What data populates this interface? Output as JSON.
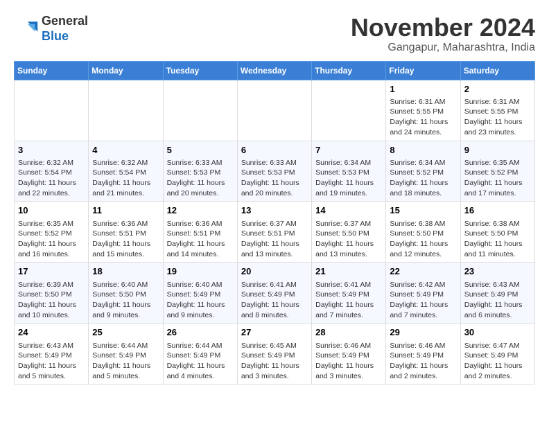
{
  "header": {
    "logo_general": "General",
    "logo_blue": "Blue",
    "month_title": "November 2024",
    "location": "Gangapur, Maharashtra, India"
  },
  "days_of_week": [
    "Sunday",
    "Monday",
    "Tuesday",
    "Wednesday",
    "Thursday",
    "Friday",
    "Saturday"
  ],
  "weeks": [
    [
      {
        "day": "",
        "info": ""
      },
      {
        "day": "",
        "info": ""
      },
      {
        "day": "",
        "info": ""
      },
      {
        "day": "",
        "info": ""
      },
      {
        "day": "",
        "info": ""
      },
      {
        "day": "1",
        "info": "Sunrise: 6:31 AM\nSunset: 5:55 PM\nDaylight: 11 hours and 24 minutes."
      },
      {
        "day": "2",
        "info": "Sunrise: 6:31 AM\nSunset: 5:55 PM\nDaylight: 11 hours and 23 minutes."
      }
    ],
    [
      {
        "day": "3",
        "info": "Sunrise: 6:32 AM\nSunset: 5:54 PM\nDaylight: 11 hours and 22 minutes."
      },
      {
        "day": "4",
        "info": "Sunrise: 6:32 AM\nSunset: 5:54 PM\nDaylight: 11 hours and 21 minutes."
      },
      {
        "day": "5",
        "info": "Sunrise: 6:33 AM\nSunset: 5:53 PM\nDaylight: 11 hours and 20 minutes."
      },
      {
        "day": "6",
        "info": "Sunrise: 6:33 AM\nSunset: 5:53 PM\nDaylight: 11 hours and 20 minutes."
      },
      {
        "day": "7",
        "info": "Sunrise: 6:34 AM\nSunset: 5:53 PM\nDaylight: 11 hours and 19 minutes."
      },
      {
        "day": "8",
        "info": "Sunrise: 6:34 AM\nSunset: 5:52 PM\nDaylight: 11 hours and 18 minutes."
      },
      {
        "day": "9",
        "info": "Sunrise: 6:35 AM\nSunset: 5:52 PM\nDaylight: 11 hours and 17 minutes."
      }
    ],
    [
      {
        "day": "10",
        "info": "Sunrise: 6:35 AM\nSunset: 5:52 PM\nDaylight: 11 hours and 16 minutes."
      },
      {
        "day": "11",
        "info": "Sunrise: 6:36 AM\nSunset: 5:51 PM\nDaylight: 11 hours and 15 minutes."
      },
      {
        "day": "12",
        "info": "Sunrise: 6:36 AM\nSunset: 5:51 PM\nDaylight: 11 hours and 14 minutes."
      },
      {
        "day": "13",
        "info": "Sunrise: 6:37 AM\nSunset: 5:51 PM\nDaylight: 11 hours and 13 minutes."
      },
      {
        "day": "14",
        "info": "Sunrise: 6:37 AM\nSunset: 5:50 PM\nDaylight: 11 hours and 13 minutes."
      },
      {
        "day": "15",
        "info": "Sunrise: 6:38 AM\nSunset: 5:50 PM\nDaylight: 11 hours and 12 minutes."
      },
      {
        "day": "16",
        "info": "Sunrise: 6:38 AM\nSunset: 5:50 PM\nDaylight: 11 hours and 11 minutes."
      }
    ],
    [
      {
        "day": "17",
        "info": "Sunrise: 6:39 AM\nSunset: 5:50 PM\nDaylight: 11 hours and 10 minutes."
      },
      {
        "day": "18",
        "info": "Sunrise: 6:40 AM\nSunset: 5:50 PM\nDaylight: 11 hours and 9 minutes."
      },
      {
        "day": "19",
        "info": "Sunrise: 6:40 AM\nSunset: 5:49 PM\nDaylight: 11 hours and 9 minutes."
      },
      {
        "day": "20",
        "info": "Sunrise: 6:41 AM\nSunset: 5:49 PM\nDaylight: 11 hours and 8 minutes."
      },
      {
        "day": "21",
        "info": "Sunrise: 6:41 AM\nSunset: 5:49 PM\nDaylight: 11 hours and 7 minutes."
      },
      {
        "day": "22",
        "info": "Sunrise: 6:42 AM\nSunset: 5:49 PM\nDaylight: 11 hours and 7 minutes."
      },
      {
        "day": "23",
        "info": "Sunrise: 6:43 AM\nSunset: 5:49 PM\nDaylight: 11 hours and 6 minutes."
      }
    ],
    [
      {
        "day": "24",
        "info": "Sunrise: 6:43 AM\nSunset: 5:49 PM\nDaylight: 11 hours and 5 minutes."
      },
      {
        "day": "25",
        "info": "Sunrise: 6:44 AM\nSunset: 5:49 PM\nDaylight: 11 hours and 5 minutes."
      },
      {
        "day": "26",
        "info": "Sunrise: 6:44 AM\nSunset: 5:49 PM\nDaylight: 11 hours and 4 minutes."
      },
      {
        "day": "27",
        "info": "Sunrise: 6:45 AM\nSunset: 5:49 PM\nDaylight: 11 hours and 3 minutes."
      },
      {
        "day": "28",
        "info": "Sunrise: 6:46 AM\nSunset: 5:49 PM\nDaylight: 11 hours and 3 minutes."
      },
      {
        "day": "29",
        "info": "Sunrise: 6:46 AM\nSunset: 5:49 PM\nDaylight: 11 hours and 2 minutes."
      },
      {
        "day": "30",
        "info": "Sunrise: 6:47 AM\nSunset: 5:49 PM\nDaylight: 11 hours and 2 minutes."
      }
    ]
  ]
}
